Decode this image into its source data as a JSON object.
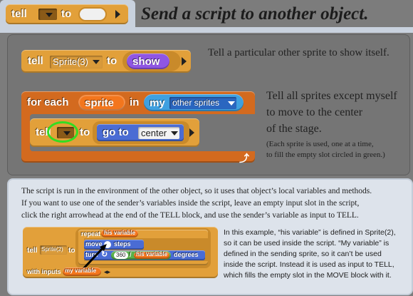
{
  "header": {
    "title": "Send a script to another object.",
    "tell_label": "tell",
    "to_label": "to"
  },
  "example1": {
    "tell_label": "tell",
    "target": "Sprite(3)",
    "to_label": "to",
    "reporter": "show",
    "caption": "Tell a particular other sprite to show itself."
  },
  "example2": {
    "for_each_label": "for each",
    "var_name": "sprite",
    "in_label": "in",
    "my_label": "my",
    "my_option": "other sprites",
    "tell_label": "tell",
    "to_label": "to",
    "goto_label": "go to",
    "goto_option": "center",
    "caption_lines": [
      "Tell all sprites except myself",
      "to move to the center",
      "of the stage."
    ],
    "caption_small_lines": [
      "(Each sprite is used, one at a time,",
      "to fill the empty slot circled in green.)"
    ]
  },
  "explain": {
    "lines": [
      "The script is run in the environment of the other object, so it uses that object’s local variables and methods.",
      "If you want to use one of the sender’s variables inside the script, leave an empty input slot in the script,",
      "click the right arrowhead at the end of the TELL block, and use the sender’s variable as input to TELL."
    ]
  },
  "example3": {
    "tell_label": "tell",
    "target": "Sprite(2)",
    "to_label": "to",
    "repeat_label": "repeat",
    "repeat_var": "his variable",
    "move_label": "move",
    "steps_label": "steps",
    "turn_label": "turn",
    "turn_number": "360",
    "slash": "/",
    "turn_var": "his variable",
    "degrees_label": "degrees",
    "with_inputs_label": "with inputs",
    "input_var": "my variable",
    "caption_lines": [
      "In this example, “his variable” is defined in Sprite(2),",
      "so it can be used inside the script.  “My variable” is",
      "defined in the sending sprite, so it can’t be used",
      "inside the script.  Instead it is used as input to TELL,",
      "which fills the empty slot in the MOVE block with it."
    ]
  },
  "colors": {
    "control": "#e2a03a",
    "loop": "#d36a1f",
    "looks": "#8f56e3",
    "motion": "#4a6cd4",
    "variables": "#f3761d",
    "lists": "#d94d11",
    "highlight_circle": "#33dd22",
    "panel_light": "#dde3eb"
  },
  "icons": [
    "ring-icon",
    "right-arrow-icon",
    "dropdown-icon",
    "loop-arrow-icon",
    "clockwise-icon"
  ]
}
